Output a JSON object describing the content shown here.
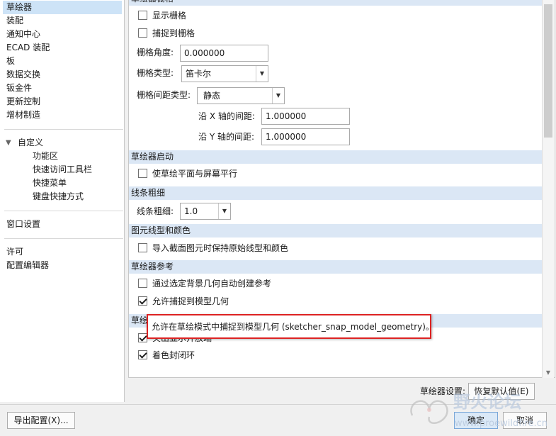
{
  "nav": {
    "top_items": [
      "草绘器",
      "装配",
      "通知中心",
      "ECAD 装配",
      "板",
      "数据交换",
      "钣金件",
      "更新控制",
      "增材制造"
    ],
    "custom_header": "自定义",
    "custom_items": [
      "功能区",
      "快速访问工具栏",
      "快捷菜单",
      "键盘快捷方式"
    ],
    "window_settings": "窗口设置",
    "license": "许可",
    "config_editor": "配置编辑器"
  },
  "sections": {
    "grid": {
      "header": "草绘器栅格",
      "show_grid": "显示栅格",
      "snap_grid": "捕捉到栅格",
      "angle_label": "栅格角度:",
      "angle_value": "0.000000",
      "type_label": "栅格类型:",
      "type_value": "笛卡尔",
      "spacing_type_label": "栅格间距类型:",
      "spacing_type_value": "静态",
      "x_spacing_label": "沿 X 轴的间距:",
      "x_spacing_value": "1.000000",
      "y_spacing_label": "沿 Y 轴的间距:",
      "y_spacing_value": "1.000000"
    },
    "startup": {
      "header": "草绘器启动",
      "parallel": "使草绘平面与屏幕平行"
    },
    "line": {
      "header": "线条粗细",
      "thickness_label": "线条粗细:",
      "thickness_value": "1.0"
    },
    "entity": {
      "header": "图元线型和颜色",
      "keep_original": "导入截面图元时保持原始线型和颜色"
    },
    "reference": {
      "header": "草绘器参考",
      "auto_create": "通过选定背景几何自动创建参考",
      "allow_snap": "允许捕捉到模型几何"
    },
    "diagnostics": {
      "header": "草绘",
      "highlight_open": "突出显示开放端",
      "shade_closed": "着色封闭环"
    }
  },
  "tooltip": "允许在草绘模式中捕捉到模型几何 (sketcher_snap_model_geometry)。",
  "footer": {
    "settings_label": "草绘器设置:",
    "restore_defaults": "恢复默认值(E)",
    "export_config": "导出配置(X)...",
    "ok": "确定",
    "cancel": "取消"
  },
  "watermark": {
    "main": "野火论坛",
    "url": "www.proewildfire.cn"
  },
  "colors": {
    "selection": "#cde3f7",
    "section_header": "#dbe7f5",
    "tooltip_border": "#dd2222"
  }
}
